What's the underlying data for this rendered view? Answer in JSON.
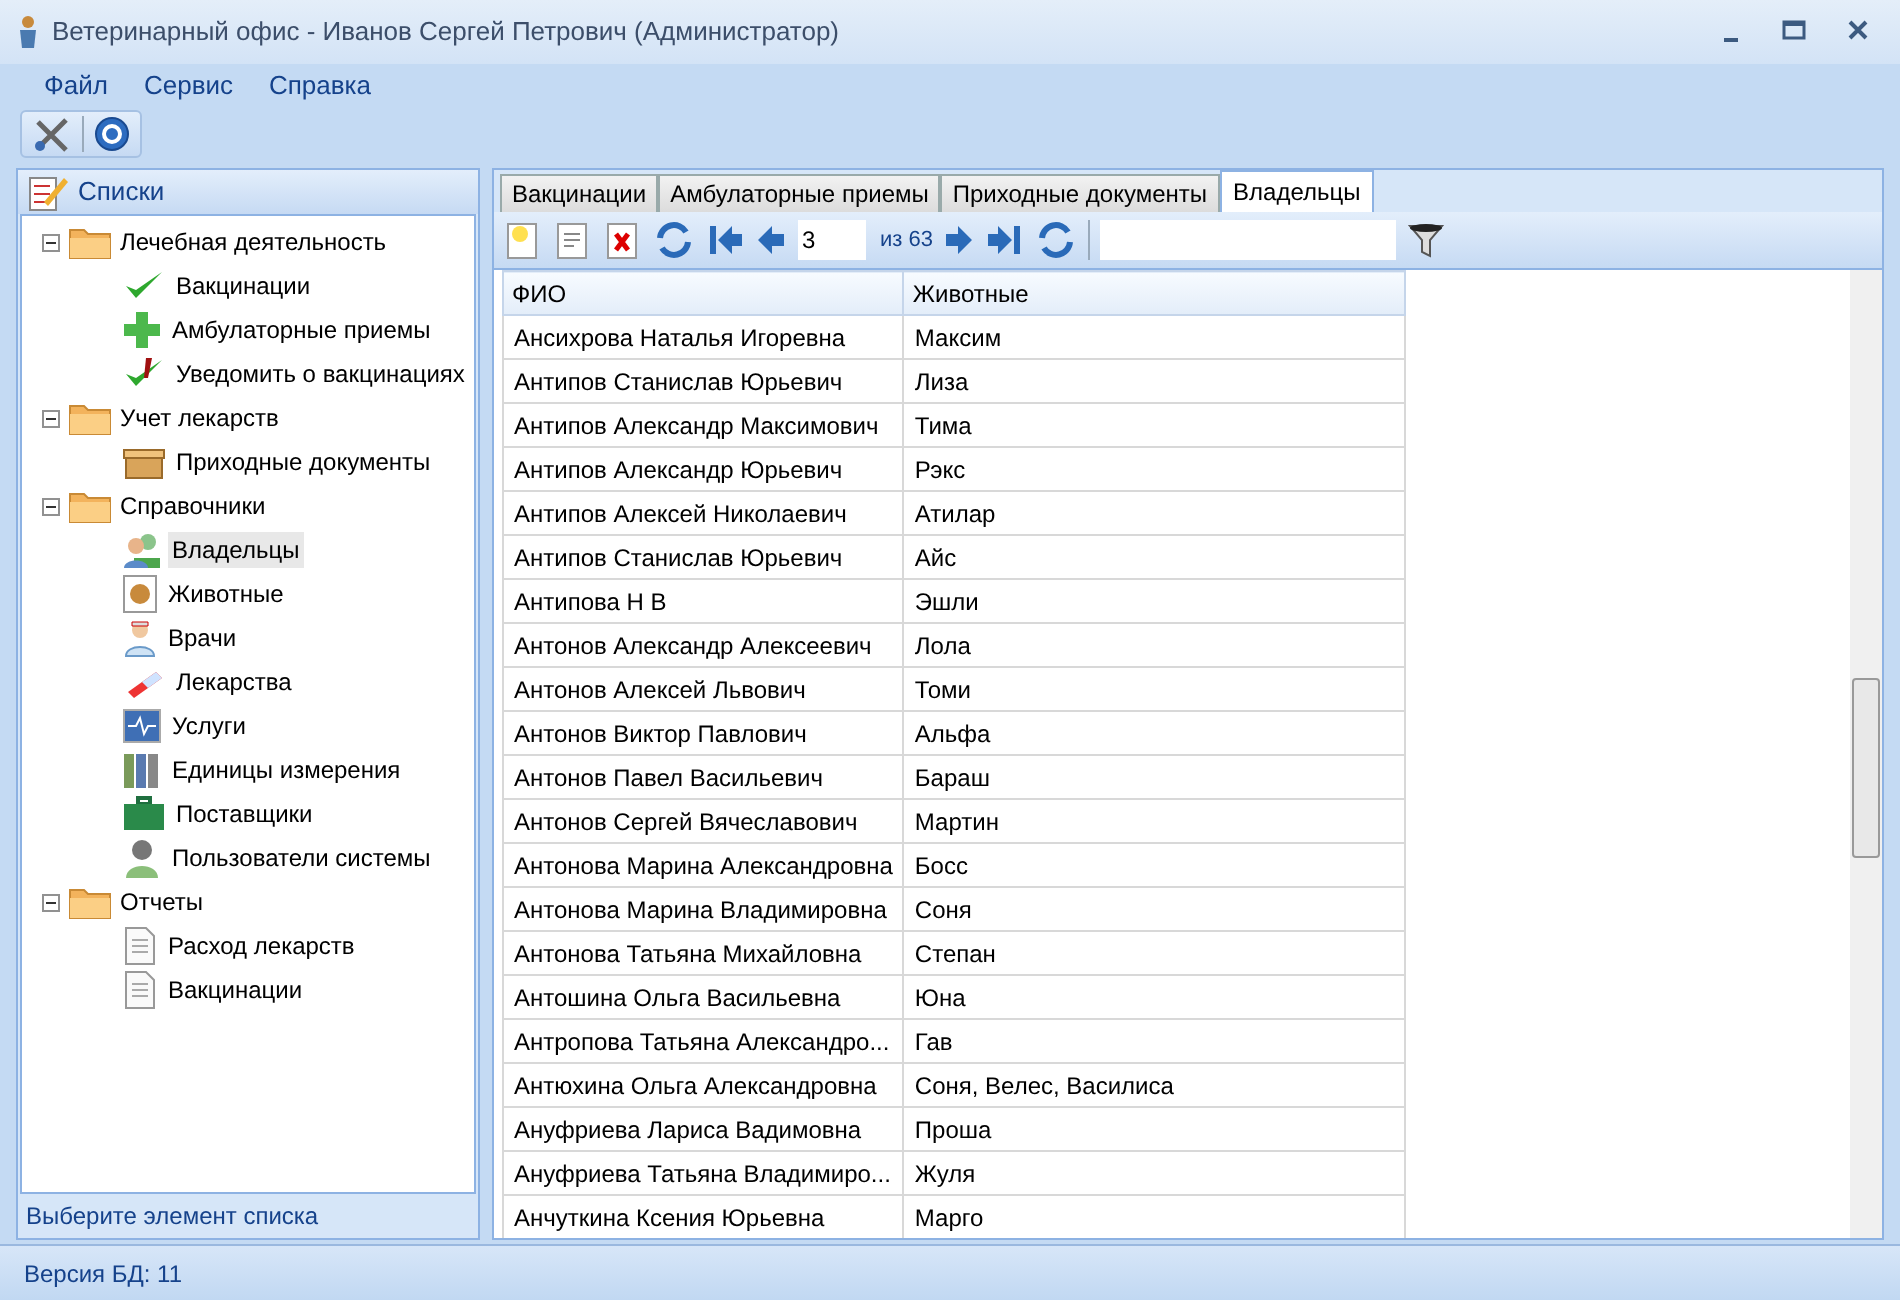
{
  "window": {
    "title": "Ветеринарный офис - Иванов Сергей Петрович (Администратор)"
  },
  "menu": [
    "Файл",
    "Сервис",
    "Справка"
  ],
  "sidebar": {
    "title": "Списки",
    "footer": "Выберите элемент списка",
    "tree": [
      {
        "label": "Лечебная деятельность",
        "expanded": true,
        "children": [
          {
            "label": "Вакцинации",
            "selected": false
          },
          {
            "label": "Амбулаторные приемы",
            "selected": false
          },
          {
            "label": "Уведомить о вакцинациях",
            "selected": false
          }
        ]
      },
      {
        "label": "Учет лекарств",
        "expanded": true,
        "children": [
          {
            "label": "Приходные документы",
            "selected": false
          }
        ]
      },
      {
        "label": "Справочники",
        "expanded": true,
        "children": [
          {
            "label": "Владельцы",
            "selected": true
          },
          {
            "label": "Животные",
            "selected": false
          },
          {
            "label": "Врачи",
            "selected": false
          },
          {
            "label": "Лекарства",
            "selected": false
          },
          {
            "label": "Услуги",
            "selected": false
          },
          {
            "label": "Единицы измерения",
            "selected": false
          },
          {
            "label": "Поставщики",
            "selected": false
          },
          {
            "label": "Пользователи системы",
            "selected": false
          }
        ]
      },
      {
        "label": "Отчеты",
        "expanded": true,
        "children": [
          {
            "label": "Расход лекарств",
            "selected": false
          },
          {
            "label": "Вакцинации",
            "selected": false
          }
        ]
      }
    ]
  },
  "tabs": [
    {
      "label": "Вакцинации",
      "selected": false
    },
    {
      "label": "Амбулаторные приемы",
      "selected": false
    },
    {
      "label": "Приходные документы",
      "selected": false
    },
    {
      "label": "Владельцы",
      "selected": true
    }
  ],
  "pager": {
    "page": "3",
    "total": "из 63"
  },
  "table": {
    "columns": [
      "ФИО",
      "Животные"
    ],
    "rows": [
      [
        "Ансихрова Наталья Игоревна",
        "Максим"
      ],
      [
        "Антипов  Станислав Юрьевич",
        "Лиза"
      ],
      [
        "Антипов Александр Максимович",
        "Тима"
      ],
      [
        "Антипов Александр Юрьевич",
        "Рэкс"
      ],
      [
        "Антипов Алексей Николаевич",
        "Атилар"
      ],
      [
        "Антипов Станислав Юрьевич",
        "Айс"
      ],
      [
        "Антипова Н В",
        "Эшли"
      ],
      [
        "Антонов Александр Алексеевич",
        "Лола"
      ],
      [
        "Антонов Алексей Львович",
        "Томи"
      ],
      [
        "Антонов Виктор Павлович",
        "Альфа"
      ],
      [
        "Антонов Павел Васильевич",
        "Бараш"
      ],
      [
        "Антонов Сергей Вячеславович",
        "Мартин"
      ],
      [
        "Антонова Марина Александровна",
        "Босс"
      ],
      [
        "Антонова Марина Владимировна",
        "Соня"
      ],
      [
        "Антонова Татьяна Михайловна",
        "Степан"
      ],
      [
        "Антошина Ольга Васильевна",
        "Юна"
      ],
      [
        "Антропова Татьяна Александро...",
        "Гав"
      ],
      [
        "Антюхина Ольга Александровна",
        "Соня, Велес, Василиса"
      ],
      [
        "Ануфриева Лариса Вадимовна",
        "Проша"
      ],
      [
        "Ануфриева Татьяна Владимиро...",
        "Жуля"
      ],
      [
        "Анчуткина Ксения Юрьевна",
        "Марго"
      ]
    ]
  },
  "status_bar": "Версия БД: 11"
}
